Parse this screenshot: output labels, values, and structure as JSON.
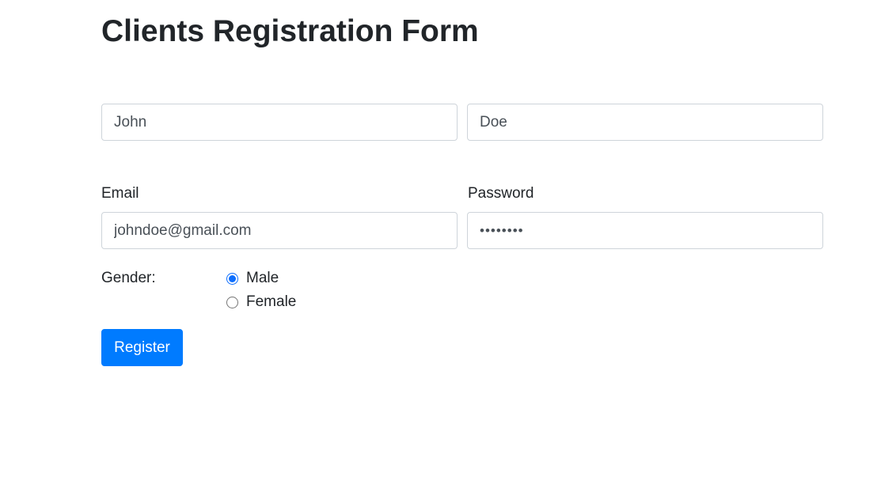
{
  "form": {
    "title": "Clients Registration Form",
    "first_name": {
      "value": "John"
    },
    "last_name": {
      "value": "Doe"
    },
    "email": {
      "label": "Email",
      "value": "johndoe@gmail.com"
    },
    "password": {
      "label": "Password",
      "value": "12345678"
    },
    "gender": {
      "label": "Gender:",
      "options": [
        {
          "label": "Male",
          "checked": true
        },
        {
          "label": "Female",
          "checked": false
        }
      ]
    },
    "submit_label": "Register"
  },
  "colors": {
    "primary": "#007bff",
    "text": "#212529",
    "input_text": "#495057",
    "input_border": "#ced4da"
  }
}
